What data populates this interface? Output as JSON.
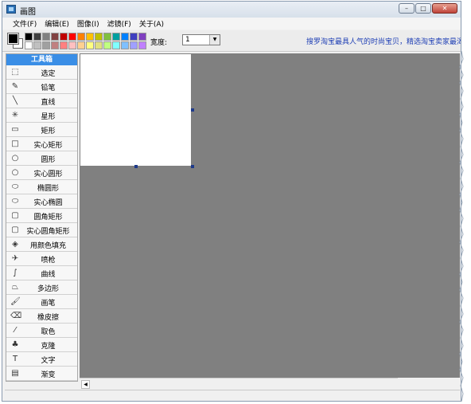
{
  "window": {
    "title": "画图"
  },
  "window_buttons": {
    "minimize": "–",
    "maximize": "□",
    "close": "✕"
  },
  "menu": [
    {
      "label": "文件(F)"
    },
    {
      "label": "编辑(E)"
    },
    {
      "label": "图像(I)"
    },
    {
      "label": "滤镜(F)"
    },
    {
      "label": "关于(A)"
    }
  ],
  "toolbar": {
    "width_label": "宽度:",
    "width_value": "1",
    "ad_text": "搜罗淘宝最具人气的时尚宝贝，精选淘宝卖家最渴望的"
  },
  "palette": [
    "#000000",
    "#404040",
    "#808080",
    "#804040",
    "#c00000",
    "#ff0000",
    "#ff8000",
    "#ffc000",
    "#c0c000",
    "#80c040",
    "#00a0a0",
    "#0080ff",
    "#4040c0",
    "#8040c0",
    "#ffffff",
    "#c0c0c0",
    "#a0a0a0",
    "#c08080",
    "#ff8080",
    "#ffc0c0",
    "#ffd090",
    "#ffff80",
    "#e0e080",
    "#c0ff80",
    "#80ffff",
    "#80c0ff",
    "#a0a0ff",
    "#c080ff"
  ],
  "current_color": {
    "foreground": "#000000",
    "background": "#ffffff"
  },
  "toolbox": {
    "header": "工具箱",
    "tools": [
      {
        "label": "选定",
        "icon": "dashed-rect-icon",
        "glyph": "⬚"
      },
      {
        "label": "铅笔",
        "icon": "pencil-icon",
        "glyph": "✎"
      },
      {
        "label": "直线",
        "icon": "line-icon",
        "glyph": "╲"
      },
      {
        "label": "星形",
        "icon": "star-icon",
        "glyph": "✳"
      },
      {
        "label": "矩形",
        "icon": "rectangle-icon",
        "glyph": "▭"
      },
      {
        "label": "实心矩形",
        "icon": "filled-rectangle-icon",
        "glyph": "□"
      },
      {
        "label": "圆形",
        "icon": "circle-icon",
        "glyph": "○"
      },
      {
        "label": "实心圆形",
        "icon": "filled-circle-icon",
        "glyph": "○"
      },
      {
        "label": "椭圆形",
        "icon": "ellipse-icon",
        "glyph": "⬭"
      },
      {
        "label": "实心椭圆",
        "icon": "filled-ellipse-icon",
        "glyph": "⬭"
      },
      {
        "label": "圆角矩形",
        "icon": "rounded-rect-icon",
        "glyph": "▢"
      },
      {
        "label": "实心圆角矩形",
        "icon": "filled-rounded-rect-icon",
        "glyph": "▢"
      },
      {
        "label": "用颜色填充",
        "icon": "fill-bucket-icon",
        "glyph": "◈"
      },
      {
        "label": "喷枪",
        "icon": "airbrush-icon",
        "glyph": "✈"
      },
      {
        "label": "曲线",
        "icon": "curve-icon",
        "glyph": "∫"
      },
      {
        "label": "多边形",
        "icon": "polygon-icon",
        "glyph": "⏢"
      },
      {
        "label": "画笔",
        "icon": "brush-icon",
        "glyph": "🖌"
      },
      {
        "label": "橡皮擦",
        "icon": "eraser-icon",
        "glyph": "⌫"
      },
      {
        "label": "取色",
        "icon": "eyedropper-icon",
        "glyph": "⁄"
      },
      {
        "label": "克隆",
        "icon": "clone-stamp-icon",
        "glyph": "♣"
      },
      {
        "label": "文字",
        "icon": "text-icon",
        "glyph": "T"
      },
      {
        "label": "渐变",
        "icon": "gradient-icon",
        "glyph": "▤"
      }
    ]
  },
  "canvas": {
    "background": "#808080",
    "paper_color": "#ffffff"
  }
}
